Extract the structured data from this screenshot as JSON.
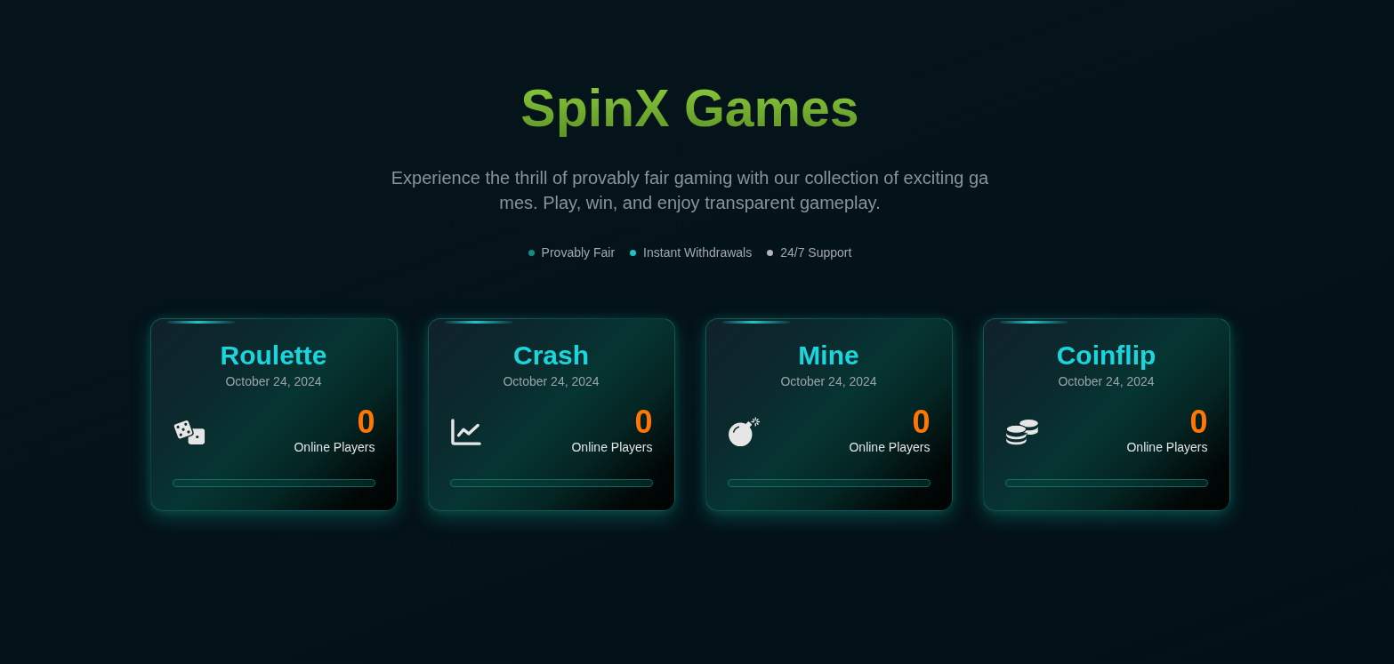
{
  "header": {
    "title": "SpinX Games",
    "subtitle": "Experience the thrill of provably fair gaming with our collection of exciting games. Play, win, and enjoy transparent gameplay.",
    "features": [
      {
        "label": "Provably Fair",
        "color": "#148c84"
      },
      {
        "label": "Instant Withdrawals",
        "color": "#18c4c4"
      },
      {
        "label": "24/7 Support",
        "color": "#b4b4bc"
      }
    ]
  },
  "games": [
    {
      "name": "Roulette",
      "date": "October 24, 2024",
      "kind": "dice",
      "players": "0",
      "players_label": "Online Players"
    },
    {
      "name": "Crash",
      "date": "October 24, 2024",
      "kind": "chart",
      "players": "0",
      "players_label": "Online Players"
    },
    {
      "name": "Mine",
      "date": "October 24, 2024",
      "kind": "bomb",
      "players": "0",
      "players_label": "Online Players"
    },
    {
      "name": "Coinflip",
      "date": "October 24, 2024",
      "kind": "coins",
      "players": "0",
      "players_label": "Online Players"
    }
  ]
}
